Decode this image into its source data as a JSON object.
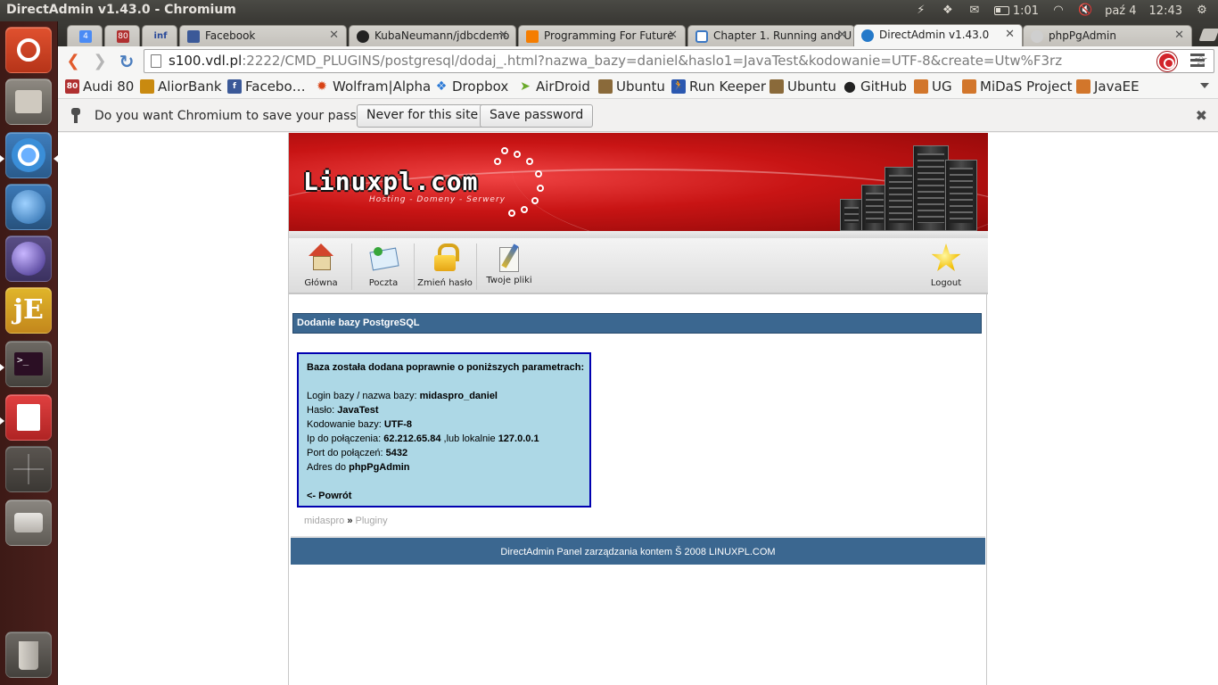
{
  "os": {
    "window_title": "DirectAdmin v1.43.0 - Chromium",
    "tray": {
      "battery_time": "1:01",
      "date": "paź 4",
      "time": "12:43"
    },
    "launcher": [
      {
        "name": "ubuntu-dash-icon"
      },
      {
        "name": "files-icon"
      },
      {
        "name": "chromium-icon"
      },
      {
        "name": "thunderbird-icon"
      },
      {
        "name": "eclipse-icon"
      },
      {
        "name": "jedit-icon",
        "text": "jE"
      },
      {
        "name": "terminal-icon",
        "text": ">_"
      },
      {
        "name": "document-viewer-icon"
      },
      {
        "name": "workspace-switcher-icon"
      },
      {
        "name": "drive-icon"
      },
      {
        "name": "trash-icon"
      }
    ]
  },
  "browser": {
    "tabs": [
      {
        "label": "4",
        "pinned": true
      },
      {
        "label": "80",
        "pinned": true
      },
      {
        "label": "inf",
        "pinned": true
      },
      {
        "label": "Facebook"
      },
      {
        "label": "KubaNeumann/jdbcdemo"
      },
      {
        "label": "Programming For Future"
      },
      {
        "label": "Chapter 1. Running and U"
      },
      {
        "label": "DirectAdmin v1.43.0",
        "active": true
      },
      {
        "label": "phpPgAdmin"
      }
    ],
    "url": {
      "host": "s100.vdl.pl",
      "rest": ":2222/CMD_PLUGINS/postgresql/dodaj_.html?nazwa_bazy=daniel&haslo1=JavaTest&kodowanie=UTF-8&create=Utw%F3rz"
    },
    "bookmarks": [
      {
        "label": "Audi 80",
        "icon_text": "80",
        "color": "#b03030"
      },
      {
        "label": "AliorBank",
        "icon_text": "",
        "color": "#c98a10"
      },
      {
        "label": "Facebo…",
        "icon_text": "f",
        "color": "#3b5998"
      },
      {
        "label": "Wolfram|Alpha",
        "icon_text": "✹",
        "color": "#d84315"
      },
      {
        "label": "Dropbox",
        "icon_text": "❖",
        "color": "#2c7ad6"
      },
      {
        "label": "AirDroid",
        "icon_text": "➤",
        "color": "#6aaa2a"
      },
      {
        "label": "Ubuntu",
        "icon_text": "",
        "color": "#8a6a3a"
      },
      {
        "label": "Run Keeper",
        "icon_text": "🏃",
        "color": "#2b58b0"
      },
      {
        "label": "Ubuntu",
        "icon_text": "",
        "color": "#8a6a3a"
      },
      {
        "label": "GitHub",
        "icon_text": "●",
        "color": "#222222"
      },
      {
        "label": "UG",
        "icon_text": "",
        "color": "#d2762b"
      },
      {
        "label": "MiDaS Project",
        "icon_text": "",
        "color": "#d2762b"
      },
      {
        "label": "JavaEE",
        "icon_text": "",
        "color": "#d2762b"
      }
    ],
    "infobar": {
      "message": "Do you want Chromium to save your passwo…",
      "never_label": "Never for this site",
      "save_label": "Save password"
    }
  },
  "site": {
    "logo": "Linuxpl.com",
    "tagline": "Hosting - Domeny - Serwery",
    "menu": [
      {
        "label": "Główna",
        "icon": "home-icon"
      },
      {
        "label": "Poczta",
        "icon": "mail-icon"
      },
      {
        "label": "Zmień hasło",
        "icon": "lock-icon"
      },
      {
        "label": "Twoje pliki",
        "icon": "files-icon"
      }
    ],
    "logout_label": "Logout",
    "section_title": "Dodanie bazy PostgreSQL",
    "result": {
      "heading": "Baza została dodana poprawnie o poniższych parametrach:",
      "login_label": "Login bazy / nazwa bazy: ",
      "login_value": "midaspro_daniel",
      "password_label": "Hasło: ",
      "password_value": "JavaTest",
      "encoding_label": "Kodowanie bazy: ",
      "encoding_value": "UTF-8",
      "ip_label": "Ip do połączenia: ",
      "ip_value": "62.212.65.84",
      "ip_local_label": " ,lub lokalnie ",
      "ip_local_value": "127.0.0.1",
      "port_label": "Port do połączeń: ",
      "port_value": "5432",
      "admin_label": "Adres do ",
      "admin_value": "phpPgAdmin",
      "back_label": "<- Powrót"
    },
    "breadcrumb": {
      "user": "midaspro",
      "separator": "»",
      "page": "Pluginy"
    },
    "footer": "DirectAdmin Panel zarządzania kontem Š 2008 LINUXPL.COM"
  }
}
